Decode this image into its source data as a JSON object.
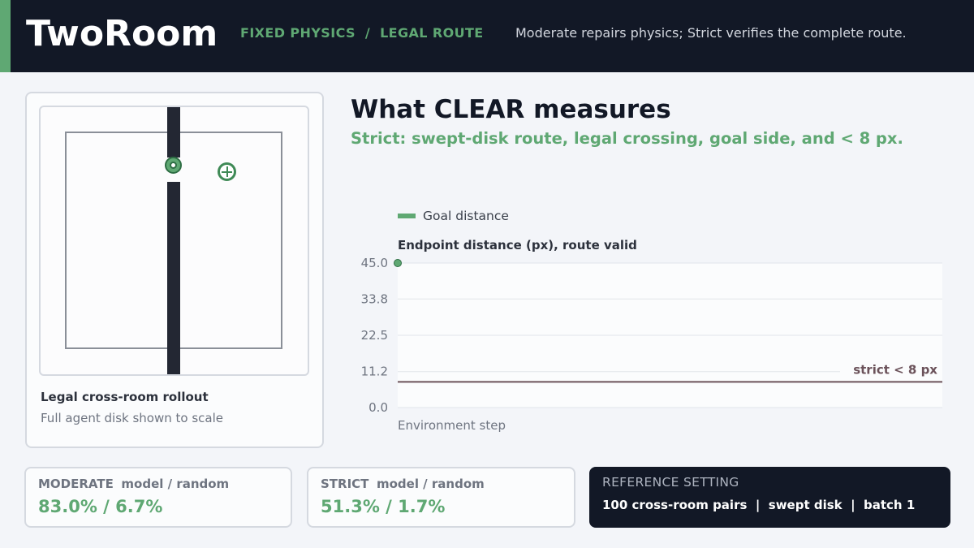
{
  "header": {
    "brand": "TwoRoom",
    "breadcrumb": "FIXED PHYSICS  /  LEGAL ROUTE",
    "tagline": "Moderate repairs physics; Strict verifies the complete route."
  },
  "simulation": {
    "title": "Legal cross-room rollout",
    "subtitle": "Full agent disk shown to scale"
  },
  "main": {
    "title": "What CLEAR measures",
    "subtitle": "Strict: swept-disk route, legal crossing, goal side, and < 8 px."
  },
  "chart_data": {
    "type": "line",
    "title": "Endpoint distance (px), route valid",
    "xlabel": "Environment step",
    "ylabel": "",
    "ylim": [
      0,
      45
    ],
    "yticks": [
      "0.0",
      "11.2",
      "22.5",
      "33.8",
      "45.0"
    ],
    "grid": true,
    "legend_position": "top-left",
    "series": [
      {
        "name": "Goal distance",
        "color": "#5fa873",
        "x": [
          0
        ],
        "values": [
          45.0
        ]
      }
    ],
    "threshold": {
      "value": 8,
      "label": "strict < 8 px",
      "color": "#6b525a"
    }
  },
  "stats": {
    "moderate": {
      "label": "MODERATE",
      "sublabel": "model / random",
      "value": "83.0% / 6.7%"
    },
    "strict": {
      "label": "STRICT",
      "sublabel": "model / random",
      "value": "51.3% / 1.7%"
    }
  },
  "reference": {
    "title": "REFERENCE SETTING",
    "value": "100 cross-room pairs  |  swept disk  |  batch 1"
  },
  "colors": {
    "header_bg": "#121826",
    "accent_green": "#5fa873",
    "wall": "#232733"
  },
  "icons": {
    "agent": "agent-disk-icon",
    "goal": "goal-crosshair-icon"
  }
}
